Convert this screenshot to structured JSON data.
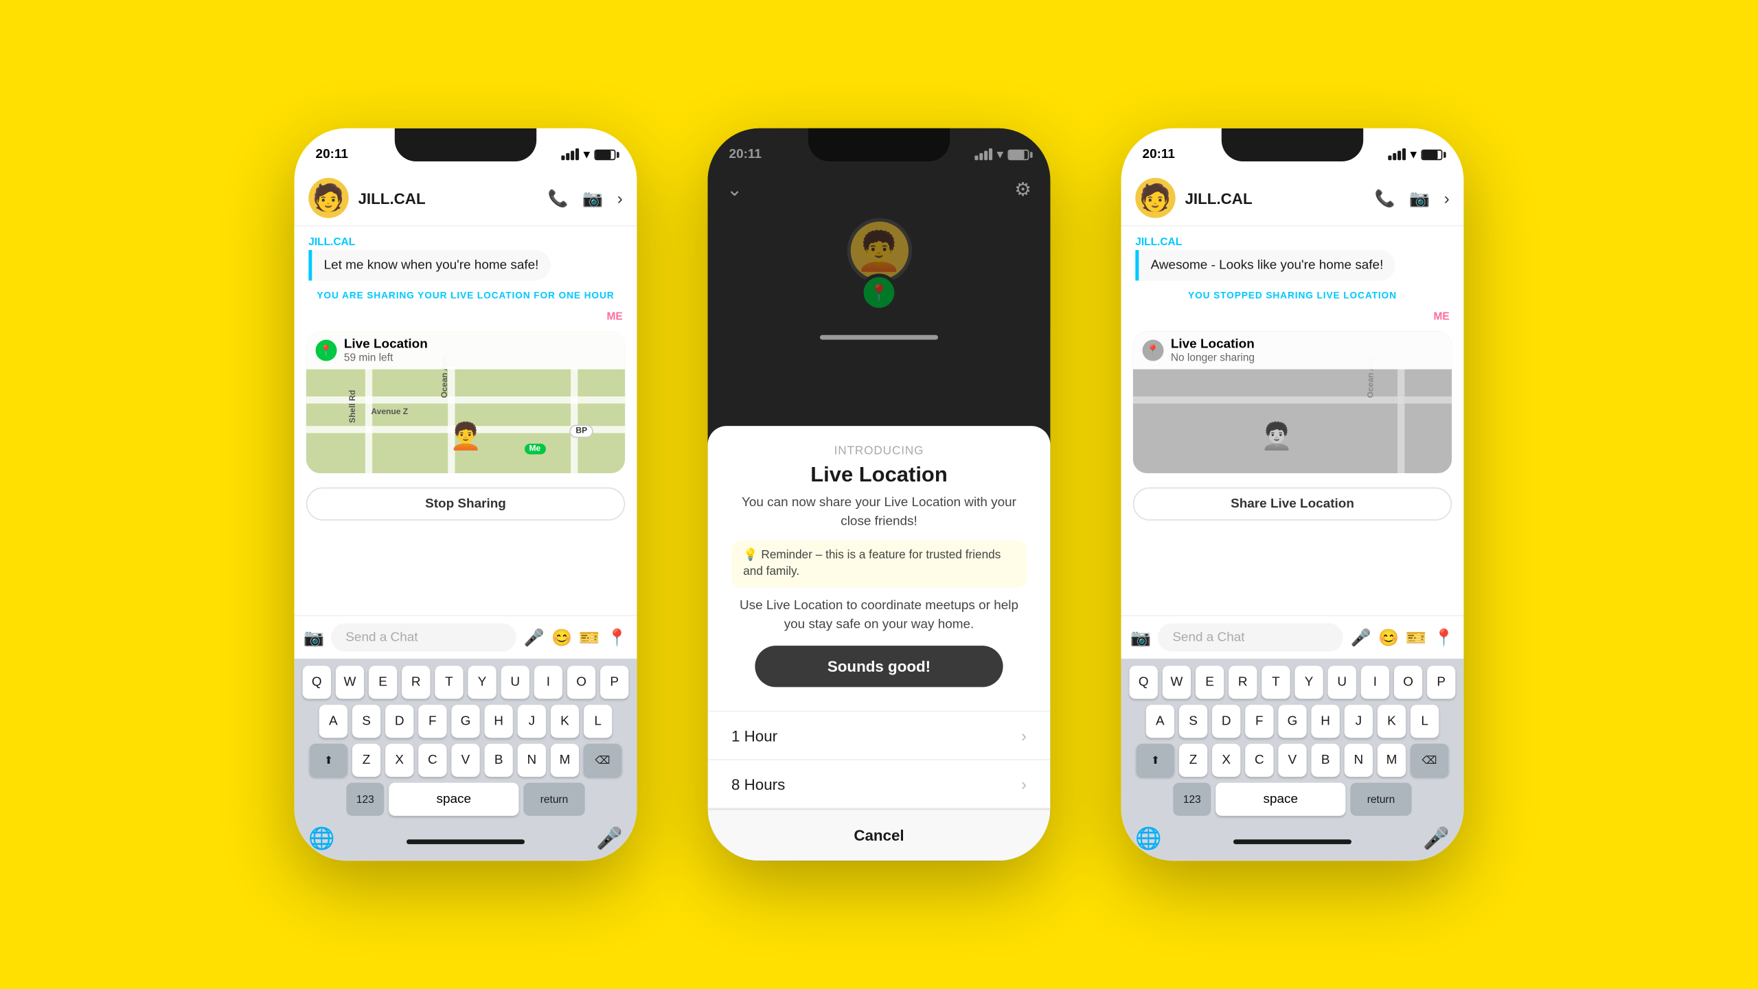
{
  "background": "#FFE000",
  "phone1": {
    "time": "20:11",
    "username": "JILL.CAL",
    "message_from": "JILL.CAL",
    "message": "Let me know when you're home safe!",
    "system_notice": "YOU ARE SHARING YOUR",
    "system_notice_highlight": "LIVE LOCATION",
    "system_notice_suffix": "FOR ONE HOUR",
    "me_label": "ME",
    "map_title": "Live Location",
    "map_subtitle": "59 min left",
    "stop_sharing": "Stop Sharing",
    "send_chat_placeholder": "Send a Chat",
    "keyboard_rows": [
      [
        "Q",
        "W",
        "E",
        "R",
        "T",
        "Y",
        "U",
        "I",
        "O",
        "P"
      ],
      [
        "A",
        "S",
        "D",
        "F",
        "G",
        "H",
        "J",
        "K",
        "L"
      ],
      [
        "Z",
        "X",
        "C",
        "V",
        "B",
        "N",
        "M"
      ]
    ],
    "key_123": "123",
    "key_space": "space",
    "key_return": "return"
  },
  "phone2": {
    "time": "20:11",
    "introducing": "Introducing",
    "modal_title": "Live Location",
    "modal_desc": "You can now share your Live Location with your close friends!",
    "modal_reminder": "💡 Reminder – this is a feature for trusted friends and family.",
    "modal_desc2": "Use Live Location to coordinate meetups or help you stay safe on your way home.",
    "modal_btn": "Sounds good!",
    "option_1hour": "1 Hour",
    "option_8hours": "8 Hours",
    "cancel": "Cancel"
  },
  "phone3": {
    "time": "20:11",
    "username": "JILL.CAL",
    "message_from": "JILL.CAL",
    "message": "Awesome - Looks like you're home safe!",
    "system_stopped": "YOU STOPPED SHARING LIVE LOCATION",
    "me_label": "ME",
    "map_title": "Live Location",
    "map_subtitle": "No longer sharing",
    "share_location": "Share Live Location",
    "send_chat_placeholder": "Send a Chat",
    "keyboard_rows": [
      [
        "Q",
        "W",
        "E",
        "R",
        "T",
        "Y",
        "U",
        "I",
        "O",
        "P"
      ],
      [
        "A",
        "S",
        "D",
        "F",
        "G",
        "H",
        "J",
        "K",
        "L"
      ],
      [
        "Z",
        "X",
        "C",
        "V",
        "B",
        "N",
        "M"
      ]
    ],
    "key_123": "123",
    "key_space": "space",
    "key_return": "return"
  }
}
